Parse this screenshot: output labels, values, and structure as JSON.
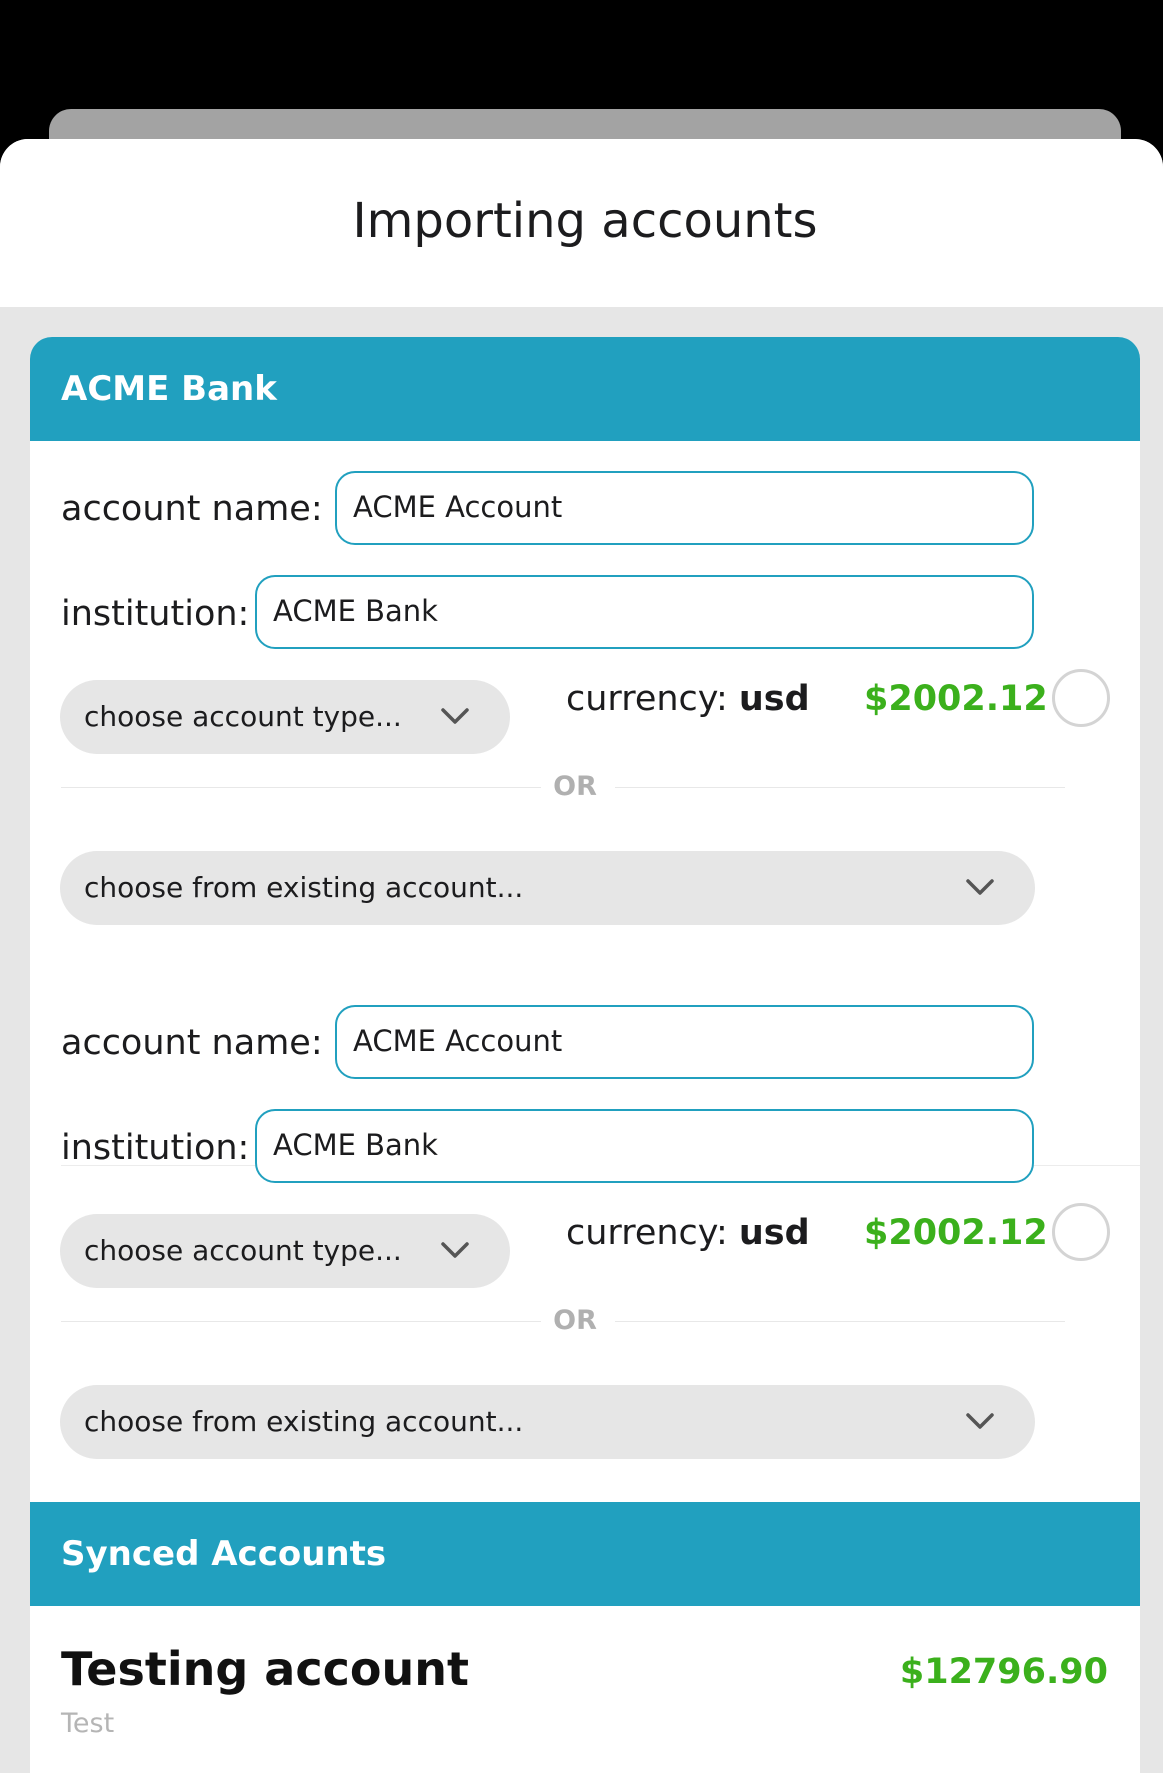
{
  "sheet": {
    "title": "Importing accounts"
  },
  "bank_section": {
    "title": "ACME Bank",
    "accounts": [
      {
        "account_name_label": "account name:",
        "account_name_value": "ACME Account",
        "institution_label": "institution:",
        "institution_value": "ACME Bank",
        "account_type_placeholder": "choose account type...",
        "currency_label": "currency:",
        "currency_value": "usd",
        "balance": "$2002.12",
        "or_label": "OR",
        "existing_account_placeholder": "choose from existing account...",
        "selected": false
      },
      {
        "account_name_label": "account name:",
        "account_name_value": "ACME Account",
        "institution_label": "institution:",
        "institution_value": "ACME Bank",
        "account_type_placeholder": "choose account type...",
        "currency_label": "currency:",
        "currency_value": "usd",
        "balance": "$2002.12",
        "or_label": "OR",
        "existing_account_placeholder": "choose from existing account...",
        "selected": false
      }
    ]
  },
  "synced_section": {
    "title": "Synced Accounts",
    "accounts": [
      {
        "name": "Testing account",
        "subtitle": "Test",
        "balance": "$12796.90"
      }
    ]
  },
  "colors": {
    "accent": "#21a0bf",
    "positive_amount": "#3bb01c",
    "sheet_background": "#e6e6e6",
    "page_background": "#000000"
  },
  "icons": {
    "dropdown": "chevron-down-icon",
    "select_toggle": "radio-circle-icon"
  }
}
